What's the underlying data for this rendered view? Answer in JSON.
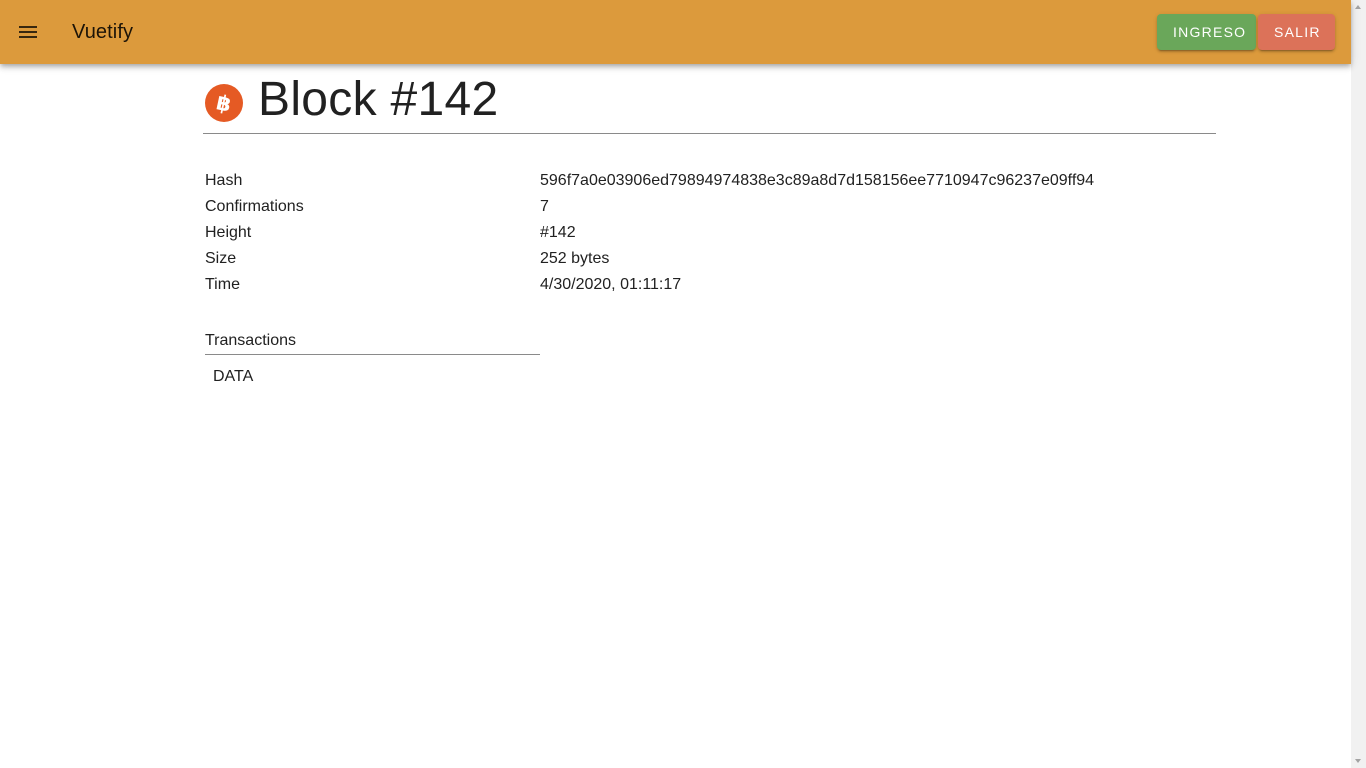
{
  "app_bar": {
    "title": "Vuetify",
    "menu_icon": "menu-icon",
    "login_label": "INGRESO",
    "logout_label": "SALIR",
    "colors": {
      "bar": "#dc9a3c",
      "login": "#6aa75a",
      "logout": "#dc7259"
    }
  },
  "block": {
    "icon": "bitcoin-icon",
    "icon_color": "#e55a24",
    "title": "Block #142",
    "details": [
      {
        "label": "Hash",
        "value": "596f7a0e03906ed79894974838e3c89a8d7d158156ee7710947c96237e09ff94"
      },
      {
        "label": "Confirmations",
        "value": "7"
      },
      {
        "label": "Height",
        "value": "#142"
      },
      {
        "label": "Size",
        "value": "252 bytes"
      },
      {
        "label": "Time",
        "value": "4/30/2020, 01:11:17"
      }
    ]
  },
  "transactions": {
    "header": "Transactions",
    "items": [
      "DATA"
    ]
  }
}
